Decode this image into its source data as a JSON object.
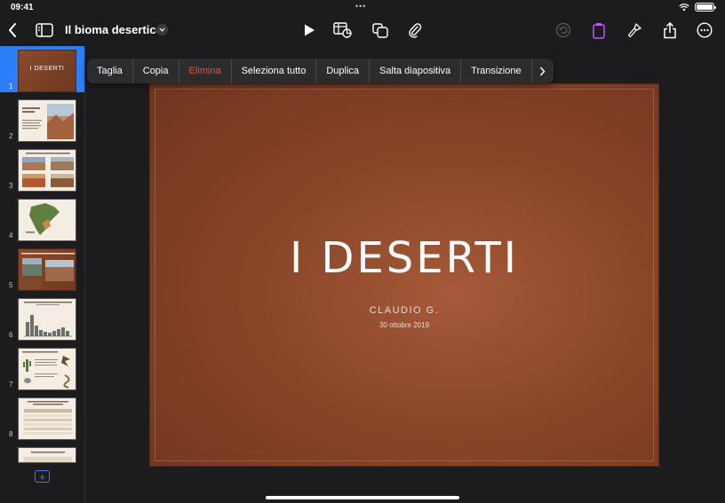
{
  "status": {
    "time": "09:41",
    "battery_level": 1.0
  },
  "toolbar": {
    "document_title": "Il bioma desertico"
  },
  "context_menu": {
    "items": [
      "Taglia",
      "Copia",
      "Elimina",
      "Seleziona tutto",
      "Duplica",
      "Salta diapositiva",
      "Transizione"
    ]
  },
  "sidebar": {
    "slides": [
      {
        "number": "1",
        "thumb_text": "I DESERTI",
        "selected": true
      },
      {
        "number": "2"
      },
      {
        "number": "3"
      },
      {
        "number": "4"
      },
      {
        "number": "5"
      },
      {
        "number": "6"
      },
      {
        "number": "7"
      },
      {
        "number": "8"
      }
    ]
  },
  "slide": {
    "title": "I DESERTI",
    "author": "CLAUDIO G.",
    "date": "30 ottobre 2019"
  },
  "colors": {
    "accent": "#2d7ff9",
    "destructive": "#ff453a",
    "slide_brown": "#8a4528",
    "toolbar_highlight": "#bf5af2"
  }
}
